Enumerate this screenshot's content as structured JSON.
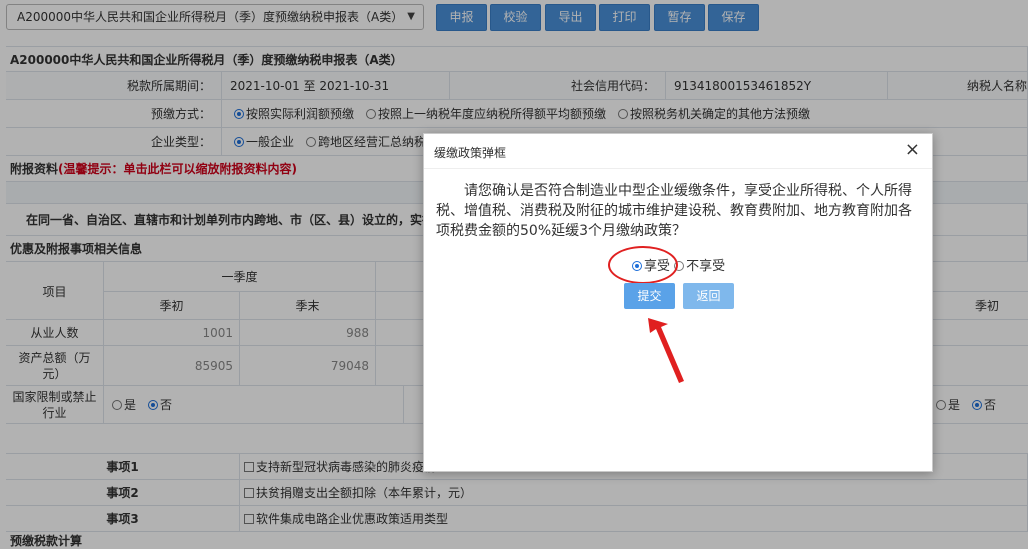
{
  "toolbar": {
    "form_select": "A200000中华人民共和国企业所得税月（季）度预缴纳税申报表（A类）",
    "buttons": [
      "申报",
      "校验",
      "导出",
      "打印",
      "暂存",
      "保存"
    ]
  },
  "form": {
    "title": "A200000中华人民共和国企业所得税月（季）度预缴纳税申报表（A类）",
    "period_label": "税款所属期间：",
    "period_value": "2021-10-01 至 2021-10-31",
    "credit_code_label": "社会信用代码：",
    "credit_code_value": "91341800153461852Y",
    "taxpayer_name_label": "纳税人名称",
    "prepay_method_label": "预缴方式：",
    "prepay_methods": [
      "按照实际利润额预缴",
      "按照上一纳税年度应纳税所得额平均额预缴",
      "按照税务机关确定的其他方法预缴"
    ],
    "enterprise_type_label": "企业类型：",
    "enterprise_types": [
      "一般企业",
      "跨地区经营汇总纳税"
    ],
    "attachment_label": "附报资料",
    "attachment_hint": "(温馨提示：单击此栏可以缩放附报资料内容)",
    "cross_region_text": "在同一省、自治区、直辖市和计划单列市内跨地、市（区、县）设立的，实行",
    "preferential_header": "优惠及附报事项相关信息",
    "item_col": "项目",
    "q1_header": "一季度",
    "quarter_start": "季初",
    "quarter_end": "季末",
    "employees_label": "从业人数",
    "employees_start": "1001",
    "employees_end": "988",
    "assets_label": "资产总额（万元）",
    "assets_start": "85905",
    "assets_end": "79048",
    "restricted_label": "国家限制或禁止行业",
    "yes": "是",
    "no": "否",
    "items": [
      {
        "label": "事项1",
        "text": "支持新型冠状病毒感染的肺炎疫情"
      },
      {
        "label": "事项2",
        "text": "扶贫捐赠支出全额扣除（本年累计，元）"
      },
      {
        "label": "事项3",
        "text": "软件集成电路企业优惠政策适用类型"
      }
    ],
    "bottom_cut_label": "预缴税款计算"
  },
  "modal": {
    "title": "缓缴政策弹框",
    "close": "×",
    "body": "请您确认是否符合制造业中型企业缓缴条件，享受企业所得税、个人所得税、增值税、消费税及附征的城市维护建设税、教育费附加、地方教育附加各项税费金额的50%延缓3个月缴纳政策？",
    "option_enjoy": "享受",
    "option_not_enjoy": "不享受",
    "submit": "提交",
    "back": "返回"
  },
  "colors": {
    "toolbar_button": "#4a90d9",
    "hint_red": "#d0021b",
    "annotation_red": "#e02020",
    "overlay": "rgba(0,0,0,0.30)"
  }
}
